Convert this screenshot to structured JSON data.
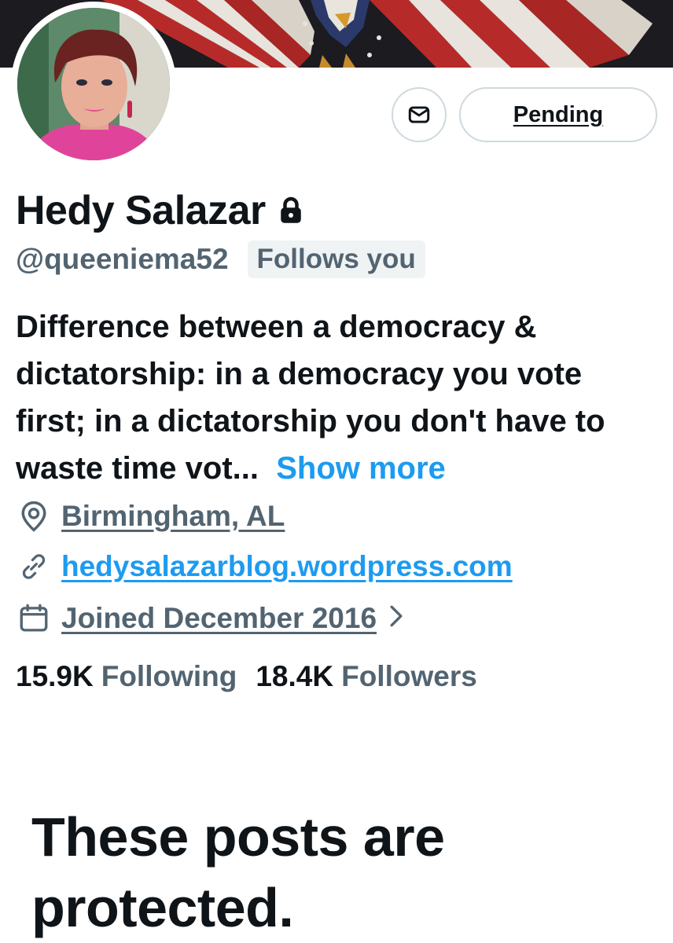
{
  "profile": {
    "name": "Hedy Salazar",
    "handle": "@queeniema52",
    "follows_you": "Follows you",
    "bio_text": "Difference between a democracy & dictatorship: in a democracy you vote first; in a dictatorship you don't have to waste time vot...",
    "show_more": "Show more",
    "location": "Birmingham, AL",
    "website": "hedysalazarblog.wordpress.com",
    "joined": "Joined December 2016"
  },
  "actions": {
    "pending_label": "Pending",
    "message_icon": "envelope-icon"
  },
  "stats": {
    "following_count": "15.9K",
    "following_label": "Following",
    "followers_count": "18.4K",
    "followers_label": "Followers"
  },
  "protected_notice": "These posts are protected.",
  "icons": [
    "lock-icon",
    "location-pin-icon",
    "link-icon",
    "calendar-icon",
    "chevron-right-icon",
    "envelope-icon"
  ],
  "colors": {
    "accent": "#1d9bf0",
    "secondary_text": "#536471",
    "primary_text": "#0f1419",
    "border": "#cfd9de"
  }
}
